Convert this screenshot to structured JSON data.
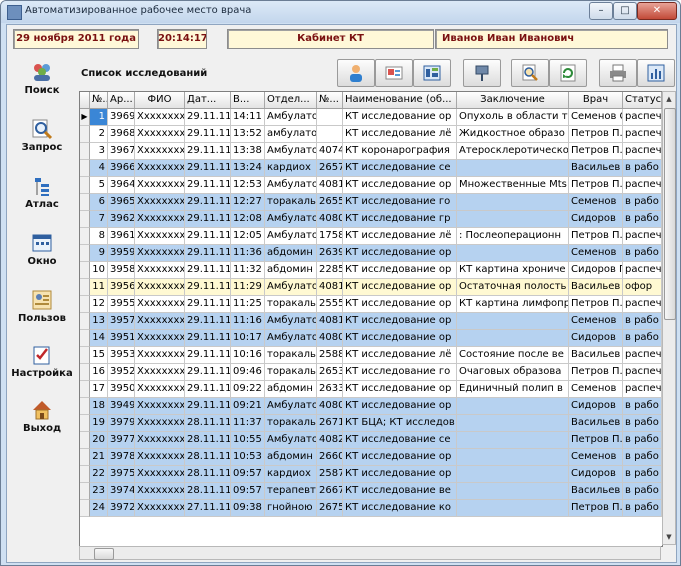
{
  "window": {
    "title": "Автоматизированное рабочее место врача",
    "minimize": "–",
    "maximize": "□",
    "close": "✕"
  },
  "info": {
    "date": "29 ноября 2011 года",
    "time": "20:14:17",
    "cabinet": "Кабинет КТ",
    "user": "Иванов Иван Иванович"
  },
  "sidebar": [
    {
      "label": "Поиск",
      "icon": "users-icon"
    },
    {
      "label": "Запрос",
      "icon": "magnifier-icon"
    },
    {
      "label": "Атлас",
      "icon": "tree-icon"
    },
    {
      "label": "Окно",
      "icon": "window-grid-icon"
    },
    {
      "label": "Пользов",
      "icon": "user-card-icon"
    },
    {
      "label": "Настройка",
      "icon": "checklist-icon"
    },
    {
      "label": "Выход",
      "icon": "home-icon"
    }
  ],
  "section_title": "Список исследований",
  "toolbar": [
    {
      "icon": "patient-icon"
    },
    {
      "icon": "image-card-icon"
    },
    {
      "icon": "scan-icon"
    },
    {
      "icon": "pin-icon"
    },
    {
      "icon": "zoom-doc-icon"
    },
    {
      "icon": "refresh-icon"
    },
    {
      "icon": "printer-icon"
    },
    {
      "icon": "chart-icon"
    }
  ],
  "columns": [
    "№..",
    "Ар...",
    "ФИО",
    "Дат...",
    "В...",
    "Отдел...",
    "№...",
    "Наименование (об...",
    "Заключение",
    "Врач",
    "Статус"
  ],
  "rows": [
    {
      "n": "1",
      "ar": "3969",
      "fio": "Хxxxxxxx",
      "date": "29.11.11",
      "time": "14:11",
      "dept": "Амбулато",
      "num": "",
      "name": "КТ исследование ор",
      "concl": "Опухоль в области т",
      "doctor": "Семенов С",
      "status": "распеч",
      "style": "white",
      "selected": true,
      "indicator": "▶"
    },
    {
      "n": "2",
      "ar": "3968",
      "fio": "Хxxxxxxx",
      "date": "29.11.11",
      "time": "13:52",
      "dept": "амбулато",
      "num": "",
      "name": "КТ исследование лё",
      "concl": "Жидкостное образо",
      "doctor": "Петров П.",
      "status": "распеч",
      "style": "white"
    },
    {
      "n": "3",
      "ar": "3967",
      "fio": "Хxxxxxxx",
      "date": "29.11.11",
      "time": "13:38",
      "dept": "Амбулато",
      "num": "4074",
      "name": "КТ коронарография",
      "concl": "Атеросклеротическо",
      "doctor": "Петров П.",
      "status": "распеч",
      "style": "white"
    },
    {
      "n": "4",
      "ar": "3966",
      "fio": "Хxxxxxxx",
      "date": "29.11.11",
      "time": "13:24",
      "dept": "кардиох",
      "num": "2657",
      "name": "КТ исследование се",
      "concl": "",
      "doctor": "Васильев",
      "status": "в рабо",
      "style": "blue"
    },
    {
      "n": "5",
      "ar": "3964",
      "fio": "Хxxxxxxx",
      "date": "29.11.11",
      "time": "12:53",
      "dept": "Амбулато",
      "num": "4081",
      "name": "КТ исследование ор",
      "concl": "Множественные Mts",
      "doctor": "Петров П.",
      "status": "распеч",
      "style": "white"
    },
    {
      "n": "6",
      "ar": "3965",
      "fio": "Хxxxxxxx",
      "date": "29.11.11",
      "time": "12:27",
      "dept": "торакалы",
      "num": "2655",
      "name": "КТ исследование го",
      "concl": "",
      "doctor": "Семенов",
      "status": "в рабо",
      "style": "blue"
    },
    {
      "n": "7",
      "ar": "3962",
      "fio": "Хxxxxxxx",
      "date": "29.11.11",
      "time": "12:08",
      "dept": "Амбулато",
      "num": "4080",
      "name": "КТ исследование гр",
      "concl": "",
      "doctor": "Сидоров",
      "status": "в рабо",
      "style": "blue"
    },
    {
      "n": "8",
      "ar": "3961",
      "fio": "Хxxxxxxx",
      "date": "29.11.11",
      "time": "12:05",
      "dept": "Амбулато",
      "num": "1758",
      "name": "КТ исследование лё",
      "concl": ": Послеоперационн",
      "doctor": "Петров П.",
      "status": "распеч",
      "style": "white"
    },
    {
      "n": "9",
      "ar": "3959",
      "fio": "Хxxxxxxx",
      "date": "29.11.11",
      "time": "11:36",
      "dept": "абдомин",
      "num": "2639",
      "name": "КТ исследование ор",
      "concl": "",
      "doctor": "Семенов",
      "status": "в рабо",
      "style": "blue"
    },
    {
      "n": "10",
      "ar": "3958",
      "fio": "Хxxxxxxx",
      "date": "29.11.11",
      "time": "11:32",
      "dept": "абдомин",
      "num": "2285",
      "name": "КТ исследование ор",
      "concl": "КТ картина хрониче",
      "doctor": "Сидоров П.",
      "status": "распеч",
      "style": "white"
    },
    {
      "n": "11",
      "ar": "3956",
      "fio": "Хxxxxxxx",
      "date": "29.11.11",
      "time": "11:29",
      "dept": "Амбулато",
      "num": "4081",
      "name": "КТ исследование ор",
      "concl": "Остаточная полость",
      "doctor": "Васильев",
      "status": "офор",
      "style": "yellow"
    },
    {
      "n": "12",
      "ar": "3955",
      "fio": "Хxxxxxxx",
      "date": "29.11.11",
      "time": "11:25",
      "dept": "торакалы",
      "num": "2555",
      "name": "КТ исследование ор",
      "concl": "КТ картина лимфопр",
      "doctor": "Петров П.",
      "status": "распеч",
      "style": "white"
    },
    {
      "n": "13",
      "ar": "3957",
      "fio": "Хxxxxxxx",
      "date": "29.11.11",
      "time": "11:16",
      "dept": "Амбулато",
      "num": "4081",
      "name": "КТ исследование ор",
      "concl": "",
      "doctor": "Семенов",
      "status": "в рабо",
      "style": "blue"
    },
    {
      "n": "14",
      "ar": "3951",
      "fio": "Хxxxxxxx",
      "date": "29.11.11",
      "time": "10:17",
      "dept": "Амбулато",
      "num": "4080",
      "name": "КТ исследование ор",
      "concl": "",
      "doctor": "Сидоров",
      "status": "в рабо",
      "style": "blue"
    },
    {
      "n": "15",
      "ar": "3953",
      "fio": "Хxxxxxxx",
      "date": "29.11.11",
      "time": "10:16",
      "dept": "торакалы",
      "num": "2588",
      "name": "КТ исследование лё",
      "concl": "Состояние после ве",
      "doctor": "Васильев",
      "status": "распеч",
      "style": "white"
    },
    {
      "n": "16",
      "ar": "3952",
      "fio": "Хxxxxxxx",
      "date": "29.11.11",
      "time": "09:46",
      "dept": "торакалы",
      "num": "2653",
      "name": "КТ исследование го",
      "concl": "Очаговых образова",
      "doctor": "Петров П.",
      "status": "распеч",
      "style": "white"
    },
    {
      "n": "17",
      "ar": "3950",
      "fio": "Хxxxxxxx",
      "date": "29.11.11",
      "time": "09:22",
      "dept": "абдомин",
      "num": "2633",
      "name": "КТ исследование ор",
      "concl": "Единичный полип в",
      "doctor": "Семенов",
      "status": "распеч",
      "style": "white"
    },
    {
      "n": "18",
      "ar": "3949",
      "fio": "Хxxxxxxx",
      "date": "29.11.11",
      "time": "09:21",
      "dept": "Амбулато",
      "num": "4080",
      "name": "КТ исследование ор",
      "concl": "",
      "doctor": "Сидоров",
      "status": "в рабо",
      "style": "blue"
    },
    {
      "n": "19",
      "ar": "3979",
      "fio": "Хxxxxxxx",
      "date": "28.11.11",
      "time": "11:37",
      "dept": "торакалы",
      "num": "2671",
      "name": "КТ БЦА; КТ исследов",
      "concl": "",
      "doctor": "Васильев",
      "status": "в рабо",
      "style": "blue"
    },
    {
      "n": "20",
      "ar": "3977",
      "fio": "Хxxxxxxx",
      "date": "28.11.11",
      "time": "10:55",
      "dept": "Амбулато",
      "num": "4082",
      "name": "КТ исследование се",
      "concl": "",
      "doctor": "Петров П.",
      "status": "в рабо",
      "style": "blue"
    },
    {
      "n": "21",
      "ar": "3978",
      "fio": "Хxxxxxxx",
      "date": "28.11.11",
      "time": "10:53",
      "dept": "абдомин",
      "num": "2660",
      "name": "КТ исследование ор",
      "concl": "",
      "doctor": "Семенов",
      "status": "в рабо",
      "style": "blue"
    },
    {
      "n": "22",
      "ar": "3975",
      "fio": "Хxxxxxxx",
      "date": "28.11.11",
      "time": "09:57",
      "dept": "кардиох",
      "num": "2587",
      "name": "КТ исследование ор",
      "concl": "",
      "doctor": "Сидоров",
      "status": "в рабо",
      "style": "blue"
    },
    {
      "n": "23",
      "ar": "3974",
      "fio": "Хxxxxxxx",
      "date": "28.11.11",
      "time": "09:57",
      "dept": "терапевт",
      "num": "2667",
      "name": "КТ исследование ве",
      "concl": "",
      "doctor": "Васильев",
      "status": "в рабо",
      "style": "blue"
    },
    {
      "n": "24",
      "ar": "3972",
      "fio": "Хxxxxxxx",
      "date": "27.11.11",
      "time": "09:38",
      "dept": "гнойною",
      "num": "2675",
      "name": "КТ исследование ко",
      "concl": "",
      "doctor": "Петров П.",
      "status": "в рабо",
      "style": "blue"
    }
  ],
  "colors": {
    "blue_row": "#b6d2f0",
    "yellow_row": "#fff9d2",
    "selected": "#3a86d6",
    "info_text": "#7a1010"
  }
}
